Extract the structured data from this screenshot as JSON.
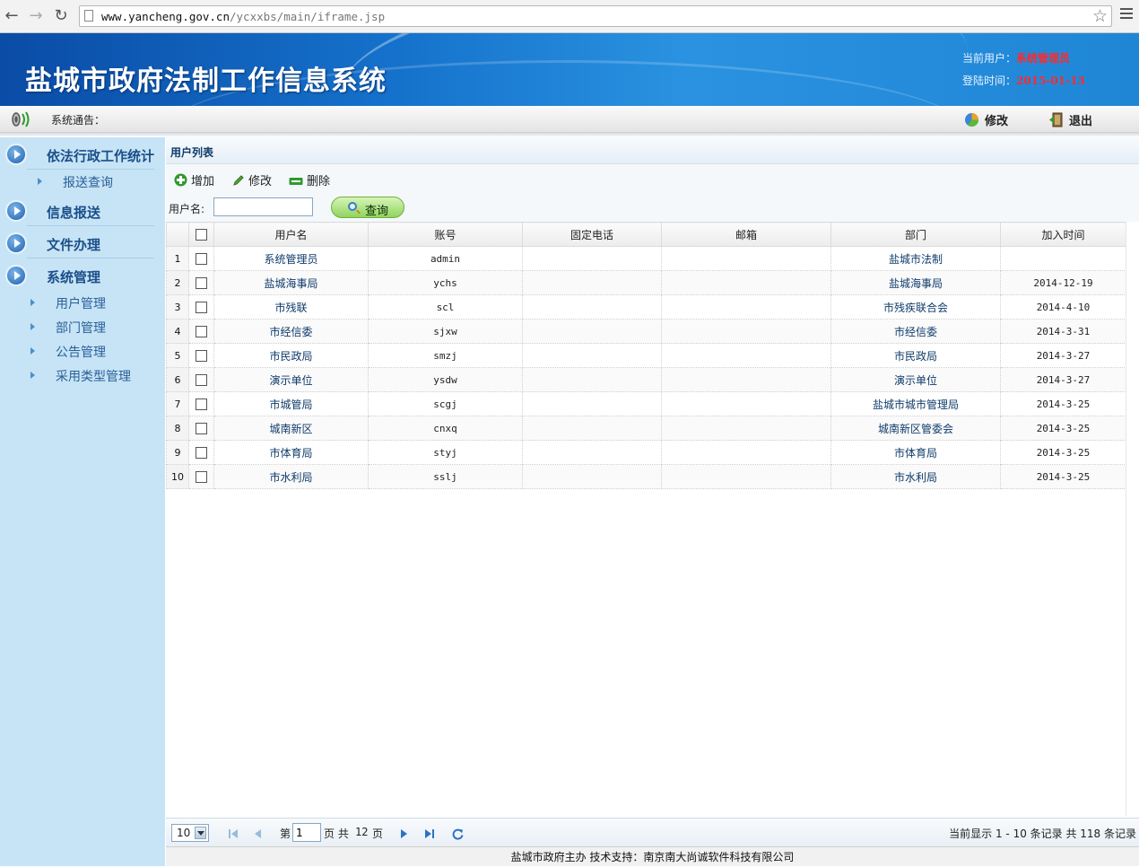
{
  "browser": {
    "url_host": "www.yancheng.gov.cn",
    "url_path": "/ycxxbs/main/iframe.jsp"
  },
  "header": {
    "title": "盐城市政府法制工作信息系统",
    "current_user_label": "当前用户：",
    "current_user": "系统管理员",
    "login_time_label": "登陆时间：",
    "login_time": "2015-01-13"
  },
  "notice": {
    "label": "系统通告：",
    "edit_label": "修改",
    "logout_label": "退出"
  },
  "sidebar": {
    "sections": [
      {
        "label": "依法行政工作统计",
        "items": [
          "报送查询"
        ]
      },
      {
        "label": "信息报送",
        "items": []
      },
      {
        "label": "文件办理",
        "items": []
      },
      {
        "label": "系统管理",
        "items": [
          "用户管理",
          "部门管理",
          "公告管理",
          "采用类型管理"
        ]
      }
    ]
  },
  "panel": {
    "title": "用户列表",
    "toolbar": {
      "add": "增加",
      "edit": "修改",
      "delete": "删除"
    },
    "search": {
      "label": "用户名:",
      "value": "",
      "button": "查询"
    }
  },
  "table": {
    "columns": [
      "用户名",
      "账号",
      "固定电话",
      "邮箱",
      "部门",
      "加入时间"
    ],
    "rows": [
      {
        "n": "1",
        "name": "系统管理员",
        "account": "admin",
        "phone": "",
        "email": "",
        "dept": "盐城市法制",
        "joined": ""
      },
      {
        "n": "2",
        "name": "盐城海事局",
        "account": "ychs",
        "phone": "",
        "email": "",
        "dept": "盐城海事局",
        "joined": "2014-12-19"
      },
      {
        "n": "3",
        "name": "市残联",
        "account": "scl",
        "phone": "",
        "email": "",
        "dept": "市残疾联合会",
        "joined": "2014-4-10"
      },
      {
        "n": "4",
        "name": "市经信委",
        "account": "sjxw",
        "phone": "",
        "email": "",
        "dept": "市经信委",
        "joined": "2014-3-31"
      },
      {
        "n": "5",
        "name": "市民政局",
        "account": "smzj",
        "phone": "",
        "email": "",
        "dept": "市民政局",
        "joined": "2014-3-27"
      },
      {
        "n": "6",
        "name": "演示单位",
        "account": "ysdw",
        "phone": "",
        "email": "",
        "dept": "演示单位",
        "joined": "2014-3-27"
      },
      {
        "n": "7",
        "name": "市城管局",
        "account": "scgj",
        "phone": "",
        "email": "",
        "dept": "盐城市城市管理局",
        "joined": "2014-3-25"
      },
      {
        "n": "8",
        "name": "城南新区",
        "account": "cnxq",
        "phone": "",
        "email": "",
        "dept": "城南新区管委会",
        "joined": "2014-3-25"
      },
      {
        "n": "9",
        "name": "市体育局",
        "account": "styj",
        "phone": "",
        "email": "",
        "dept": "市体育局",
        "joined": "2014-3-25"
      },
      {
        "n": "10",
        "name": "市水利局",
        "account": "sslj",
        "phone": "",
        "email": "",
        "dept": "市水利局",
        "joined": "2014-3-25"
      }
    ]
  },
  "pager": {
    "page_size": "10",
    "page_prefix": "第",
    "page_value": "1",
    "page_mid": "页 共",
    "total_pages": "12",
    "page_suffix": "页",
    "info": "当前显示 1 - 10 条记录 共 118 条记录"
  },
  "footer": {
    "text": "盐城市政府主办  技术支持：南京南大尚诚软件科技有限公司"
  }
}
